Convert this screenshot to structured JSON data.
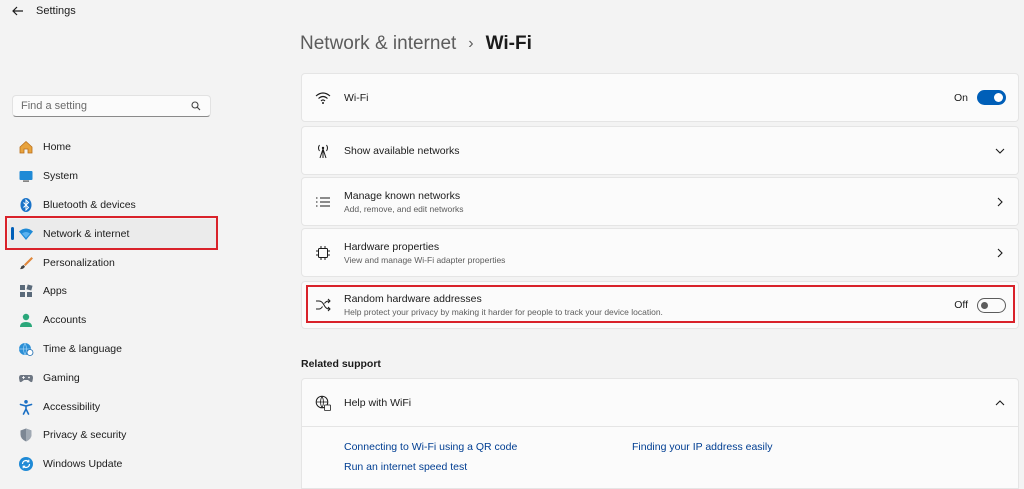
{
  "app": {
    "title": "Settings"
  },
  "search": {
    "placeholder": "Find a setting"
  },
  "sidebar": {
    "items": [
      {
        "label": "Home"
      },
      {
        "label": "System"
      },
      {
        "label": "Bluetooth & devices"
      },
      {
        "label": "Network & internet"
      },
      {
        "label": "Personalization"
      },
      {
        "label": "Apps"
      },
      {
        "label": "Accounts"
      },
      {
        "label": "Time & language"
      },
      {
        "label": "Gaming"
      },
      {
        "label": "Accessibility"
      },
      {
        "label": "Privacy & security"
      },
      {
        "label": "Windows Update"
      }
    ],
    "active_item": "Network & internet"
  },
  "breadcrumb": {
    "parent": "Network & internet",
    "separator": "›",
    "current": "Wi-Fi"
  },
  "cards": {
    "wifi": {
      "title": "Wi-Fi",
      "state": "On"
    },
    "available": {
      "title": "Show available networks"
    },
    "known": {
      "title": "Manage known networks",
      "subtitle": "Add, remove, and edit networks"
    },
    "hardware": {
      "title": "Hardware properties",
      "subtitle": "View and manage Wi-Fi adapter properties"
    },
    "random": {
      "title": "Random hardware addresses",
      "subtitle": "Help protect your privacy by making it harder for people to track your device location.",
      "state": "Off"
    }
  },
  "related": {
    "heading": "Related support",
    "help": {
      "title": "Help with WiFi",
      "links": [
        "Connecting to Wi-Fi using a QR code",
        "Finding your IP address easily",
        "Run an internet speed test"
      ]
    }
  },
  "colors": {
    "accent": "#005fb8",
    "highlight": "#d9222a",
    "link": "#003e92"
  }
}
